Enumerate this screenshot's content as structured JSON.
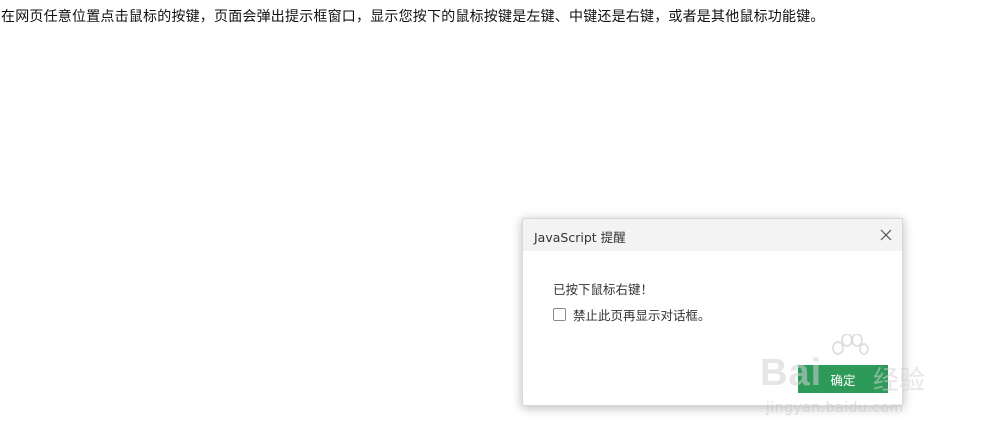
{
  "page": {
    "instruction_text": "在网页任意位置点击鼠标的按键，页面会弹出提示框窗口，显示您按下的鼠标按键是左键、中键还是右键，或者是其他鼠标功能键。"
  },
  "dialog": {
    "title": "JavaScript 提醒",
    "close_icon": "close-icon",
    "message": "已按下鼠标右键！",
    "checkbox": {
      "label": "禁止此页再显示对话框。",
      "checked": false
    },
    "ok_button_label": "确定",
    "ok_button_color": "#2e9a5a"
  },
  "watermark": {
    "logo_text": "Bai",
    "logo_text_cn": "经验",
    "url": "jingyan.baidu.com"
  }
}
